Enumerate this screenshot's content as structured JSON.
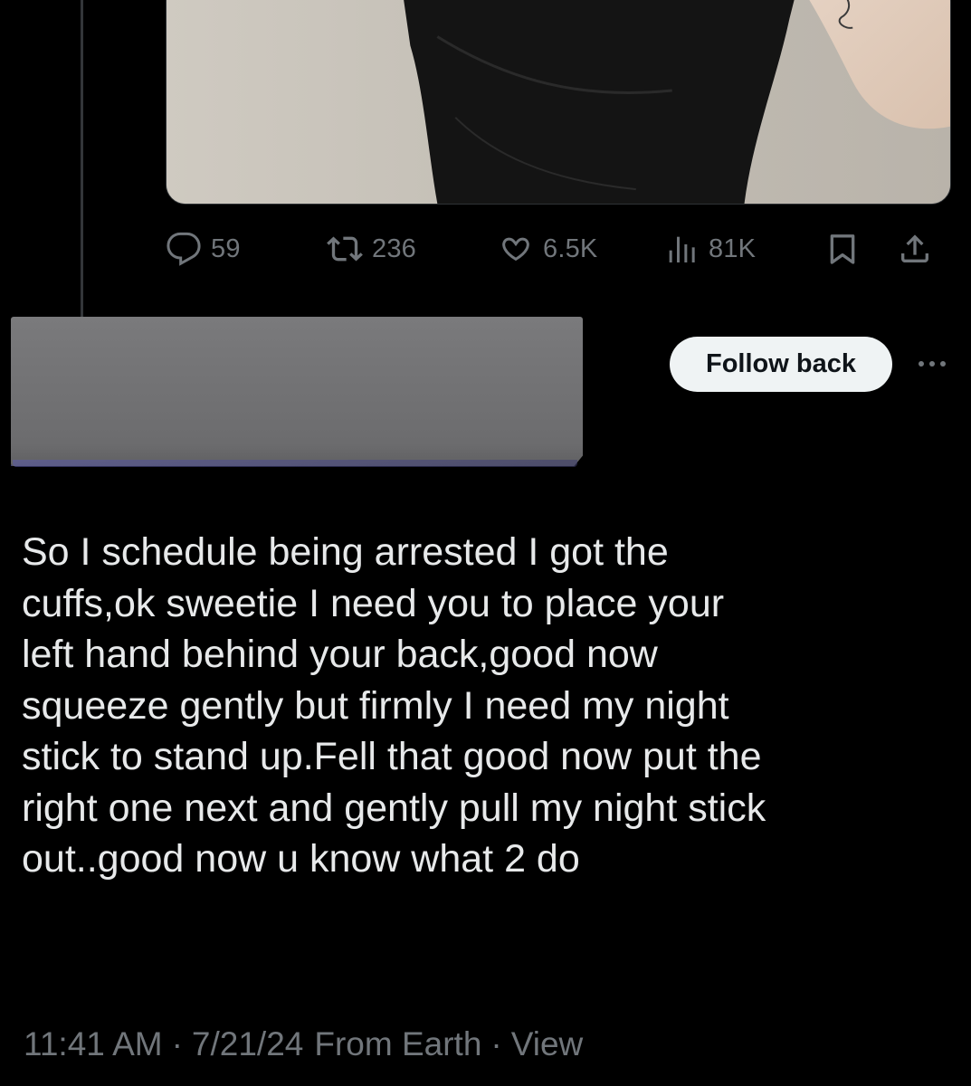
{
  "post_actions": {
    "reply_count": "59",
    "repost_count": "236",
    "like_count": "6.5K",
    "view_count": "81K"
  },
  "icons": {
    "reply": "reply-icon",
    "repost": "repost-icon",
    "like": "heart-icon",
    "views": "views-chart-icon",
    "bookmark": "bookmark-icon",
    "share": "share-icon",
    "more": "more-dots-icon"
  },
  "reply": {
    "follow_label": "Follow back",
    "text": "So I schedule being arrested I got the\ncuffs,ok sweetie I need you to place your\nleft hand behind your back,good now\nsqueeze gently but firmly I need my night\nstick to stand up.Fell that good now put the\nright one next and gently pull my night stick\nout..good now u know what 2 do",
    "time": "11:41 AM",
    "date": "7/21/24",
    "source": "From Earth",
    "view_link": "View"
  },
  "colors": {
    "background": "#000000",
    "text": "#e7e9ea",
    "muted": "#71767b",
    "button_bg": "#eff3f4",
    "button_text": "#0f1419",
    "redaction": "#707072"
  }
}
